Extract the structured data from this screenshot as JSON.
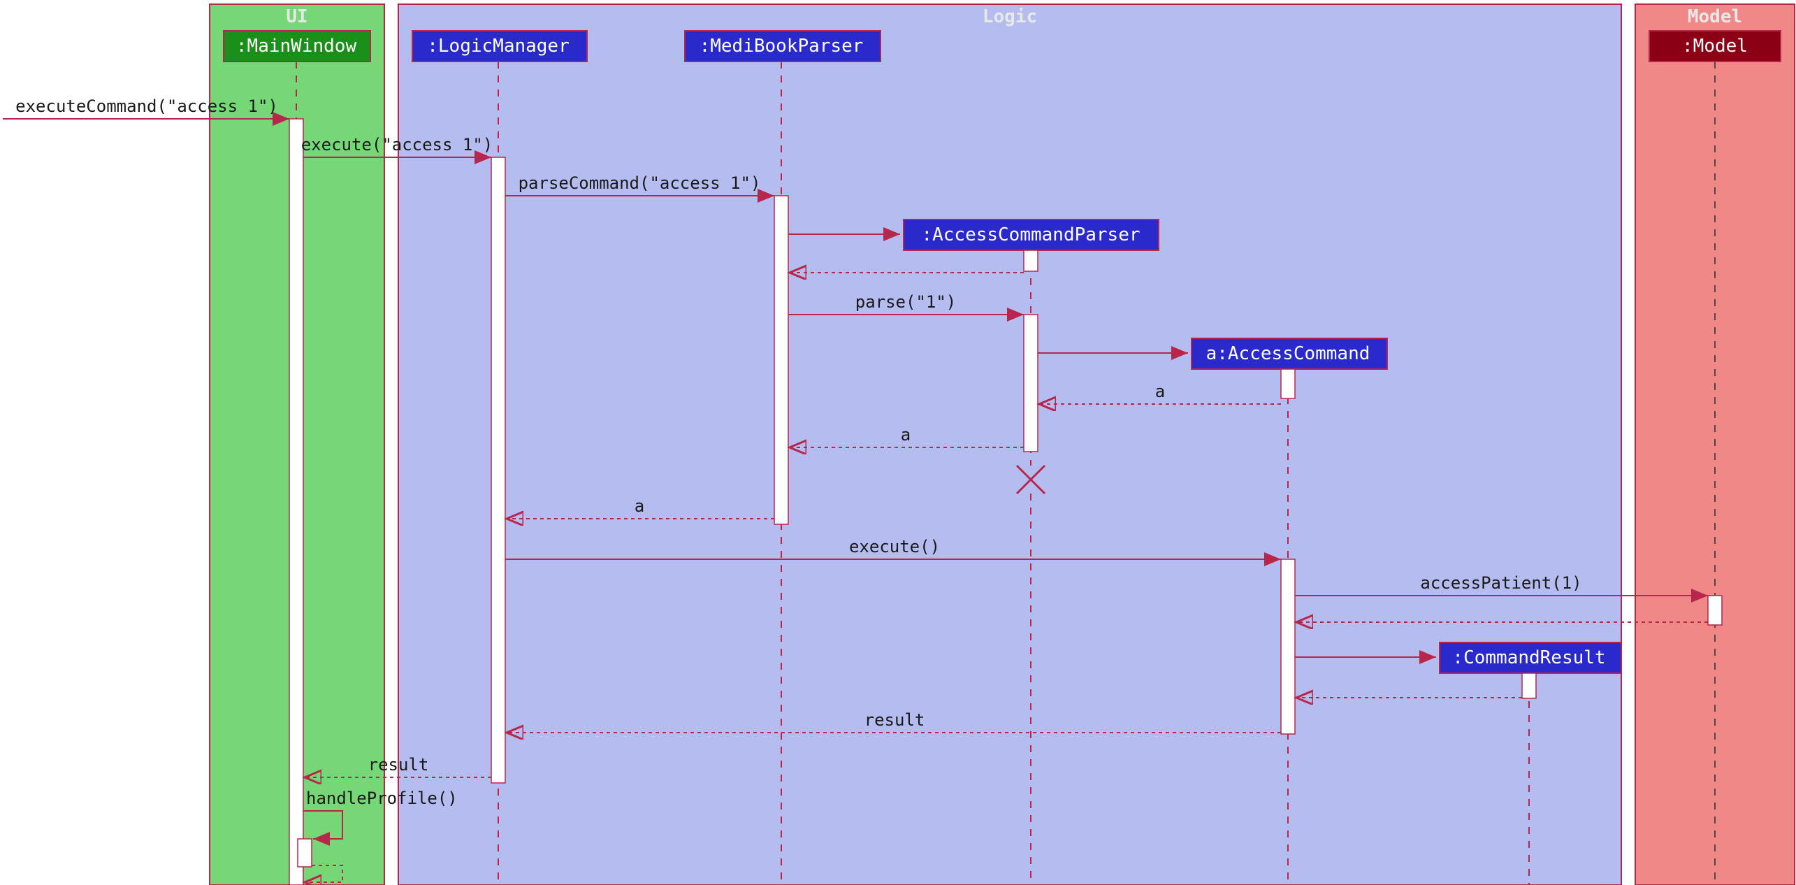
{
  "boxes": {
    "ui": {
      "label": "UI"
    },
    "logic": {
      "label": "Logic"
    },
    "model": {
      "label": "Model"
    }
  },
  "participants": {
    "mainWindow": ":MainWindow",
    "logicManager": ":LogicManager",
    "mediBookParser": ":MediBookParser",
    "accessCommandParser": ":AccessCommandParser",
    "accessCommand": "a:AccessCommand",
    "commandResult": ":CommandResult",
    "modelP": ":Model"
  },
  "messages": {
    "m1": "executeCommand(\"access 1\")",
    "m2": "execute(\"access 1\")",
    "m3": "parseCommand(\"access 1\")",
    "m4": "parse(\"1\")",
    "m5": "a",
    "m6": "a",
    "m7": "a",
    "m8": "execute()",
    "m9": "accessPatient(1)",
    "m10": "result",
    "m11": "result",
    "m12": "handleProfile()"
  },
  "chart_data": {
    "type": "sequence-diagram",
    "title": "Access Command Sequence",
    "boxes": [
      {
        "name": "UI",
        "participants": [
          ":MainWindow"
        ]
      },
      {
        "name": "Logic",
        "participants": [
          ":LogicManager",
          ":MediBookParser",
          ":AccessCommandParser",
          "a:AccessCommand",
          ":CommandResult"
        ]
      },
      {
        "name": "Model",
        "participants": [
          ":Model"
        ]
      }
    ],
    "messages": [
      {
        "from": "external",
        "to": ":MainWindow",
        "label": "executeCommand(\"access 1\")",
        "type": "call"
      },
      {
        "from": ":MainWindow",
        "to": ":LogicManager",
        "label": "execute(\"access 1\")",
        "type": "call"
      },
      {
        "from": ":LogicManager",
        "to": ":MediBookParser",
        "label": "parseCommand(\"access 1\")",
        "type": "call"
      },
      {
        "from": ":MediBookParser",
        "to": ":AccessCommandParser",
        "label": "",
        "type": "create"
      },
      {
        "from": ":AccessCommandParser",
        "to": ":MediBookParser",
        "label": "",
        "type": "return"
      },
      {
        "from": ":MediBookParser",
        "to": ":AccessCommandParser",
        "label": "parse(\"1\")",
        "type": "call"
      },
      {
        "from": ":AccessCommandParser",
        "to": "a:AccessCommand",
        "label": "",
        "type": "create"
      },
      {
        "from": "a:AccessCommand",
        "to": ":AccessCommandParser",
        "label": "a",
        "type": "return"
      },
      {
        "from": ":AccessCommandParser",
        "to": ":MediBookParser",
        "label": "a",
        "type": "return"
      },
      {
        "from": ":AccessCommandParser",
        "to": ":AccessCommandParser",
        "label": "",
        "type": "destroy"
      },
      {
        "from": ":MediBookParser",
        "to": ":LogicManager",
        "label": "a",
        "type": "return"
      },
      {
        "from": ":LogicManager",
        "to": "a:AccessCommand",
        "label": "execute()",
        "type": "call"
      },
      {
        "from": "a:AccessCommand",
        "to": ":Model",
        "label": "accessPatient(1)",
        "type": "call"
      },
      {
        "from": ":Model",
        "to": "a:AccessCommand",
        "label": "",
        "type": "return"
      },
      {
        "from": "a:AccessCommand",
        "to": ":CommandResult",
        "label": "",
        "type": "create"
      },
      {
        "from": ":CommandResult",
        "to": "a:AccessCommand",
        "label": "",
        "type": "return"
      },
      {
        "from": "a:AccessCommand",
        "to": ":LogicManager",
        "label": "result",
        "type": "return"
      },
      {
        "from": ":LogicManager",
        "to": ":MainWindow",
        "label": "result",
        "type": "return"
      },
      {
        "from": ":MainWindow",
        "to": ":MainWindow",
        "label": "handleProfile()",
        "type": "self"
      }
    ]
  }
}
